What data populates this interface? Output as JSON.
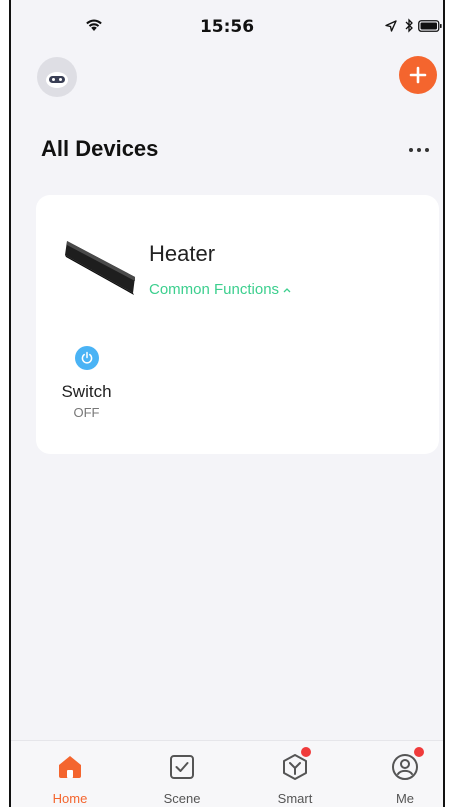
{
  "status_bar": {
    "time": "15:56"
  },
  "header": {
    "avatar_icon": "robot-avatar-icon",
    "add_icon": "plus-icon"
  },
  "main": {
    "title": "All Devices",
    "more_icon": "more-dots-icon"
  },
  "device": {
    "name": "Heater",
    "common_functions_label": "Common Functions",
    "functions": [
      {
        "label": "Switch",
        "state": "OFF",
        "icon": "power-icon"
      }
    ]
  },
  "tabs": [
    {
      "label": "Home",
      "icon": "home-icon",
      "active": true,
      "badge": false
    },
    {
      "label": "Scene",
      "icon": "scene-check-icon",
      "active": false,
      "badge": false
    },
    {
      "label": "Smart",
      "icon": "smart-cube-icon",
      "active": false,
      "badge": true
    },
    {
      "label": "Me",
      "icon": "profile-icon",
      "active": false,
      "badge": true
    }
  ],
  "colors": {
    "accent": "#f4652e",
    "functions_green": "#3ccf8e",
    "power_blue": "#4ab3f5",
    "badge_red": "#f03b3b",
    "background": "#f4f4f8"
  }
}
